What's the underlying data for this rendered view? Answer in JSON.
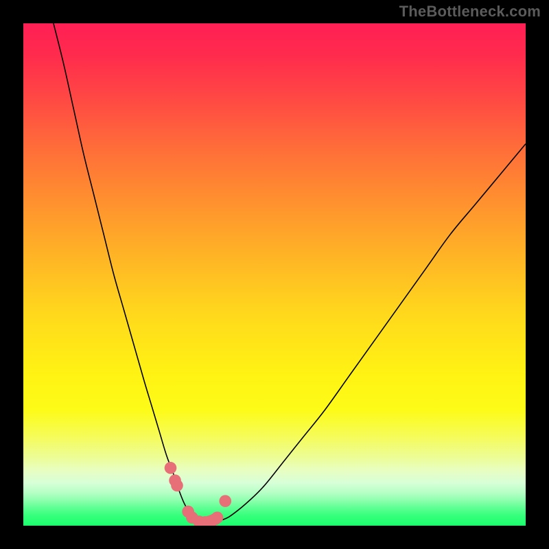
{
  "watermark": "TheBottleneck.com",
  "colors": {
    "frame": "#000000",
    "curve_stroke": "#000000",
    "marker_fill": "#e76f77",
    "grad_top": "#ff1f55",
    "grad_bottom": "#1cff6e"
  },
  "chart_data": {
    "type": "line",
    "title": "",
    "xlabel": "",
    "ylabel": "",
    "xlim": [
      0,
      100
    ],
    "ylim": [
      0,
      100
    ],
    "grid": false,
    "legend": false,
    "series": [
      {
        "name": "bottleneck-curve",
        "x": [
          6,
          8,
          10,
          12,
          14,
          16,
          18,
          20,
          22,
          24,
          25.5,
          27,
          28.5,
          30,
          31,
          32,
          33,
          34,
          35,
          36,
          37.5,
          40,
          42,
          45,
          48,
          52,
          56,
          60,
          65,
          70,
          75,
          80,
          85,
          90,
          95,
          100
        ],
        "y": [
          100,
          92,
          83,
          74,
          66,
          58,
          50,
          43,
          36,
          29,
          24,
          19,
          14,
          10,
          7,
          4.5,
          2.7,
          1.4,
          0.7,
          0.6,
          0.7,
          1.3,
          2.5,
          5,
          8,
          13,
          18,
          23,
          30,
          37,
          44,
          51,
          58,
          64,
          70,
          76
        ]
      }
    ],
    "markers": {
      "name": "highlight-points",
      "x": [
        29.3,
        30.2,
        30.6,
        32.8,
        33.6,
        35.0,
        36.2,
        37.0,
        37.6,
        38.2,
        38.6,
        40.2
      ],
      "y": [
        11.5,
        9.0,
        8.0,
        2.8,
        1.6,
        0.8,
        0.7,
        0.8,
        1.0,
        1.3,
        1.6,
        4.9
      ]
    },
    "annotations": []
  }
}
